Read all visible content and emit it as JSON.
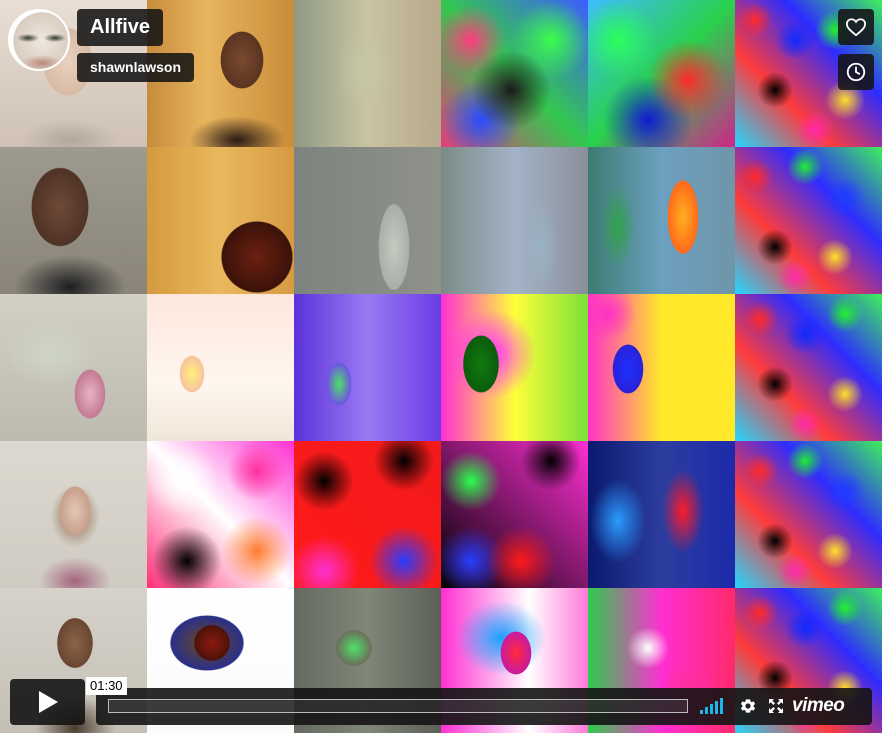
{
  "video": {
    "title": "Allfive",
    "owner": "shawnlawson"
  },
  "actions": {
    "like_icon": "heart-icon",
    "watch_later_icon": "clock-icon"
  },
  "controls": {
    "timecode": "01:30",
    "progress": 0.0,
    "play_icon": "play-icon",
    "volume_icon": "volume-bars-icon",
    "settings_icon": "gear-icon",
    "fullscreen_icon": "fullscreen-icon",
    "logo": "vimeo"
  },
  "colors": {
    "overlay": "#141414",
    "accent": "#1ab7ea"
  }
}
